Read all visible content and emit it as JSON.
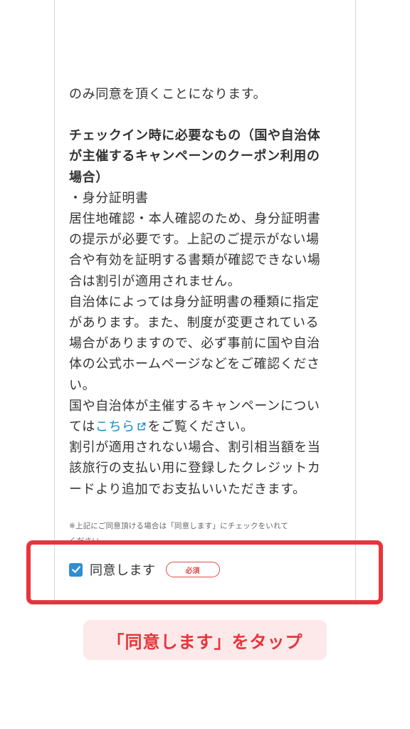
{
  "terms": {
    "prev_line": "のみ同意を頂くことになります。",
    "heading_lines": [
      "チェックイン時に必要なもの（国や自治体",
      "が主催するキャンペーンのクーポン利用の",
      "場合）"
    ],
    "item_label": "・身分証明書",
    "body_lines": [
      "居住地確認・本人確認のため、身分証明書",
      "の提示が必要です。上記のご提示がない場",
      "合や有効を証明する書類が確認できない場",
      "合は割引が適用されません。",
      "自治体によっては身分証明書の種類に指定",
      "があります。また、制度が変更されている",
      "場合がありますので、必ず事前に国や自治",
      "体の公式ホームページなどをご確認くださ",
      "い。",
      "国や自治体が主催するキャンペーンについ"
    ],
    "link_prefix": "ては",
    "link_text": "こちら",
    "link_suffix": "をご覧ください。",
    "closing_lines": [
      "割引が適用されない場合、割引相当額を当",
      "該旅行の支払い用に登録したクレジットカ",
      "ードより追加でお支払いいただきます。"
    ]
  },
  "note": {
    "line1": "※上記にご同意頂ける場合は「同意します」にチェックをいれて",
    "line2": "ください。"
  },
  "agreement": {
    "checked": true,
    "label": "同意します",
    "required_badge": "必須"
  },
  "caption": "「同意します」をタップ",
  "colors": {
    "accent_red": "#e8343c",
    "link_blue": "#1a8fc1",
    "checkbox_blue": "#2d8ed2",
    "caption_bg": "#fde9e9"
  },
  "icons": {
    "external_link": "external-link-icon",
    "checkmark": "checkmark-icon"
  }
}
